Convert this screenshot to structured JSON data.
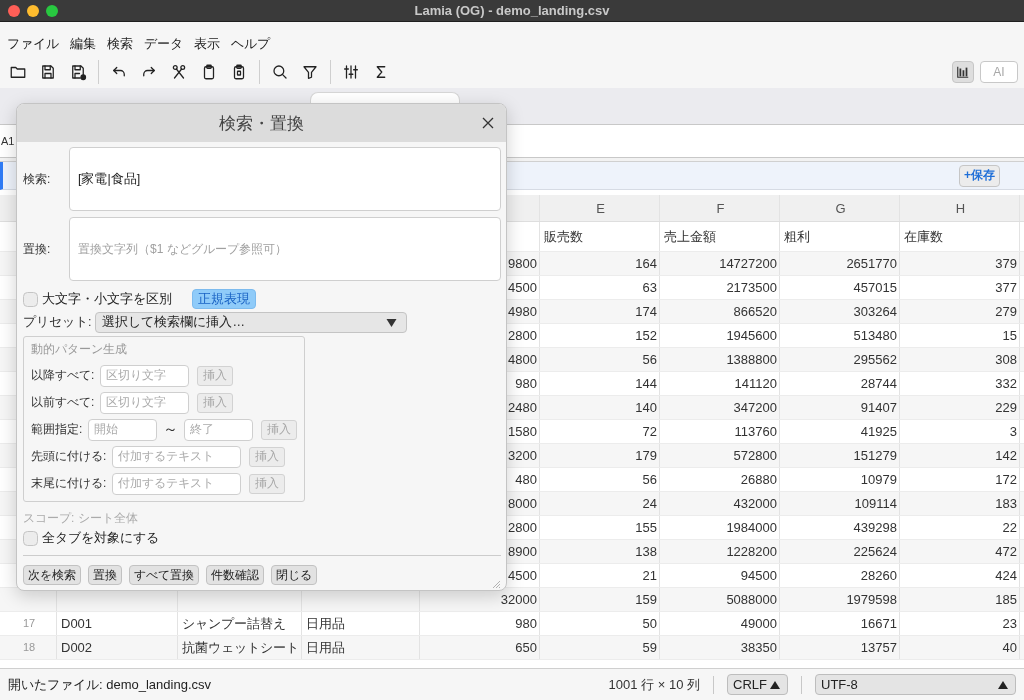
{
  "window": {
    "title": "Lamia (OG) - demo_landing.csv"
  },
  "menu": [
    "ファイル",
    "編集",
    "検索",
    "データ",
    "表示",
    "ヘルプ"
  ],
  "toolbar": {
    "chart_button": {
      "on": true
    },
    "ai_button": {
      "label": "AI",
      "disabled": true
    }
  },
  "tabs": [
    {
      "selected": true
    }
  ],
  "formula_bar": {
    "cell_ref": "A1"
  },
  "filter_bar": {
    "save_button": "+保存"
  },
  "grid": {
    "columns": [
      "E",
      "F",
      "G",
      "H"
    ],
    "rows": [
      {
        "kind": "header",
        "cells": [
          "販売数",
          "売上金額",
          "粗利",
          "在庫数"
        ]
      },
      {
        "kind": "record",
        "cells": [
          "9800",
          "164",
          "14727200",
          "2651770",
          "379"
        ]
      },
      {
        "kind": "record",
        "cells": [
          "4500",
          "63",
          "2173500",
          "457015",
          "377"
        ]
      },
      {
        "kind": "record",
        "cells": [
          "4980",
          "174",
          "866520",
          "303264",
          "279"
        ]
      },
      {
        "kind": "record",
        "cells": [
          "2800",
          "152",
          "1945600",
          "513480",
          "15"
        ]
      },
      {
        "kind": "record",
        "cells": [
          "4800",
          "56",
          "1388800",
          "295562",
          "308"
        ]
      },
      {
        "kind": "record",
        "cells": [
          "980",
          "144",
          "141120",
          "28744",
          "332"
        ]
      },
      {
        "kind": "record",
        "cells": [
          "2480",
          "140",
          "347200",
          "91407",
          "229"
        ]
      },
      {
        "kind": "record",
        "cells": [
          "1580",
          "72",
          "113760",
          "41925",
          "3"
        ]
      },
      {
        "kind": "record",
        "cells": [
          "3200",
          "179",
          "572800",
          "151279",
          "142"
        ]
      },
      {
        "kind": "record",
        "cells": [
          "480",
          "56",
          "26880",
          "10979",
          "172"
        ]
      },
      {
        "kind": "record",
        "cells": [
          "8000",
          "24",
          "432000",
          "109114",
          "183"
        ]
      },
      {
        "kind": "record",
        "cells": [
          "2800",
          "155",
          "1984000",
          "439298",
          "22"
        ]
      },
      {
        "kind": "record",
        "cells": [
          "8900",
          "138",
          "1228200",
          "225624",
          "472"
        ]
      },
      {
        "kind": "record",
        "cells": [
          "4500",
          "21",
          "94500",
          "28260",
          "424"
        ]
      },
      {
        "kind": "record",
        "cells": [
          "32000",
          "159",
          "5088000",
          "1979598",
          "185"
        ]
      },
      {
        "kind": "record",
        "number": "17",
        "cells": [
          "D001",
          "シャンプー詰替え",
          "日用品",
          "980",
          "50",
          "49000",
          "16671",
          "23"
        ]
      },
      {
        "kind": "record",
        "number": "18",
        "cells": [
          "D002",
          "抗菌ウェットシート",
          "日用品",
          "650",
          "59",
          "38350",
          "13757",
          "40"
        ]
      }
    ]
  },
  "find_replace_dialog": {
    "title": "検索・置換",
    "find": {
      "label": "検索:",
      "value": "[家電|食品]"
    },
    "replace": {
      "label": "置換:",
      "placeholder": "置換文字列（$1 などグループ参照可）"
    },
    "match_case": {
      "label": "大文字・小文字を区別",
      "checked": false
    },
    "regex": {
      "label": "正規表現",
      "on": true
    },
    "preset": {
      "label": "プリセット:",
      "value": "選択して検索欄に挿入…"
    },
    "pattern_group": {
      "title": "動的パターン生成",
      "rows": [
        {
          "kind": "delimiter",
          "label": "以降すべて:",
          "fields": [
            {
              "placeholder": "区切り文字"
            }
          ],
          "button": {
            "label": "挿入",
            "disabled": true
          }
        },
        {
          "kind": "delimiter",
          "label": "以前すべて:",
          "fields": [
            {
              "placeholder": "区切り文字"
            }
          ],
          "button": {
            "label": "挿入",
            "disabled": true
          }
        },
        {
          "kind": "range",
          "label": "範囲指定:",
          "fields": [
            {
              "placeholder": "開始"
            },
            {
              "placeholder": "終了"
            }
          ],
          "separator": "～",
          "button": {
            "label": "挿入",
            "disabled": true
          }
        },
        {
          "kind": "affix",
          "label": "先頭に付ける:",
          "fields": [
            {
              "placeholder": "付加するテキスト"
            }
          ],
          "button": {
            "label": "挿入",
            "disabled": true
          }
        },
        {
          "kind": "affix",
          "label": "末尾に付ける:",
          "fields": [
            {
              "placeholder": "付加するテキスト"
            }
          ],
          "button": {
            "label": "挿入",
            "disabled": true
          }
        }
      ]
    },
    "scope": "スコープ: シート全体",
    "all_tabs": {
      "label": "全タブを対象にする",
      "checked": false
    },
    "buttons": [
      "次を検索",
      "置換",
      "すべて置換",
      "件数確認",
      "閉じる"
    ]
  },
  "status_bar": {
    "message": "開いたファイル: demo_landing.csv",
    "dimensions": "1001 行 × 10 列",
    "line_ending": "CRLF",
    "encoding": "UTF-8"
  }
}
